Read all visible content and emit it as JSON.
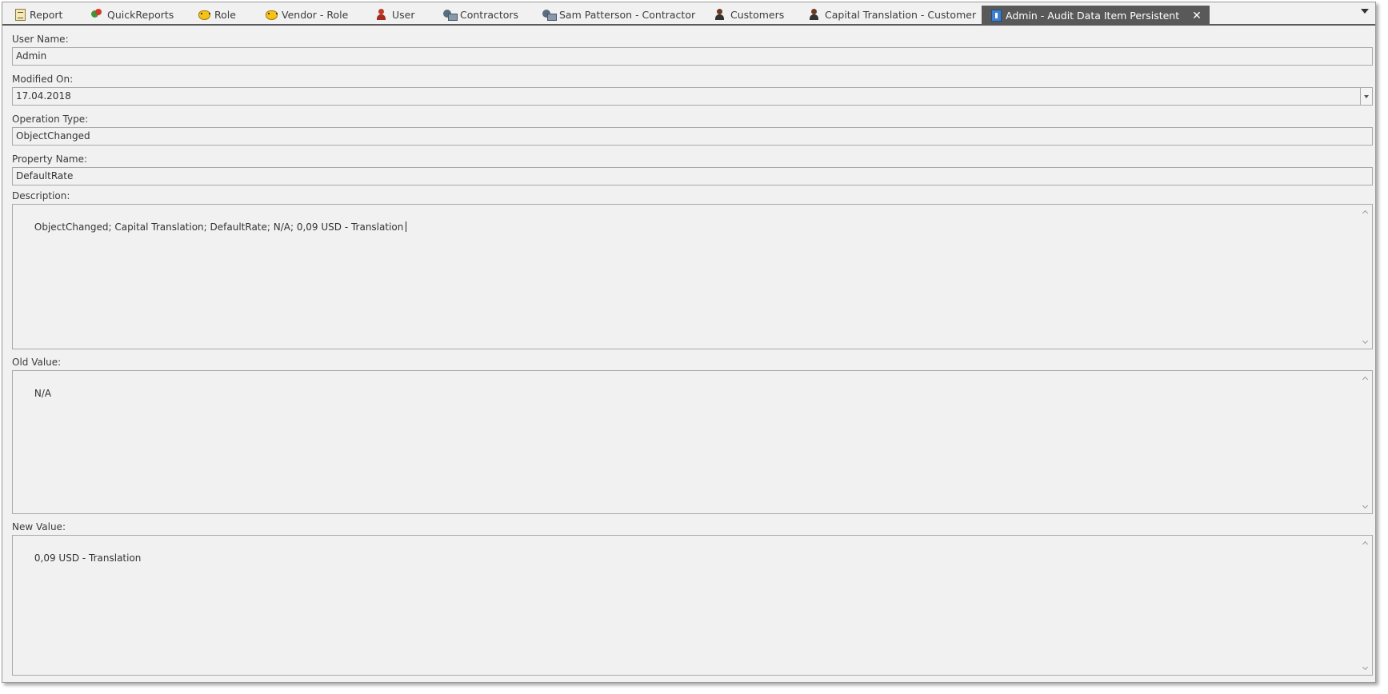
{
  "tabs": [
    {
      "label": "Report",
      "icon": "report-icon"
    },
    {
      "label": "QuickReports",
      "icon": "quick-reports-icon"
    },
    {
      "label": "Role",
      "icon": "role-mask-icon"
    },
    {
      "label": "Vendor - Role",
      "icon": "role-mask-icon"
    },
    {
      "label": "User",
      "icon": "user-icon"
    },
    {
      "label": "Contractors",
      "icon": "contractor-icon"
    },
    {
      "label": "Sam Patterson - Contractor",
      "icon": "contractor-icon"
    },
    {
      "label": "Customers",
      "icon": "customer-icon"
    },
    {
      "label": "Capital Translation - Customer",
      "icon": "customer-icon"
    },
    {
      "label": "Admin - Audit Data Item Persistent",
      "icon": "audit-icon",
      "active": true
    }
  ],
  "tab_close_glyph": "✕",
  "form": {
    "user_name_label": "User Name:",
    "user_name_value": "Admin",
    "modified_on_label": "Modified On:",
    "modified_on_value": "17.04.2018",
    "operation_type_label": "Operation Type:",
    "operation_type_value": "ObjectChanged",
    "property_name_label": "Property Name:",
    "property_name_value": "DefaultRate",
    "description_label": "Description:",
    "description_value": "ObjectChanged; Capital Translation; DefaultRate; N/A; 0,09 USD - Translation",
    "old_value_label": "Old Value:",
    "old_value_value": "N/A",
    "new_value_label": "New Value:",
    "new_value_value": "0,09 USD - Translation"
  },
  "colors": {
    "active_tab_bg": "#595959",
    "panel_bg": "#f1f1f1",
    "field_border": "#a9a9a9"
  }
}
